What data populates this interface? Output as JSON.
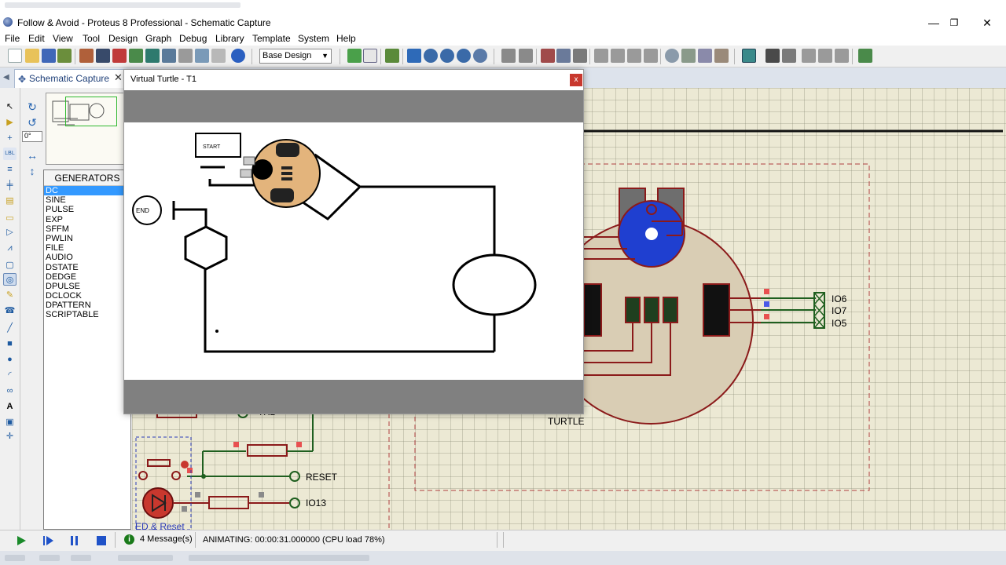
{
  "window": {
    "title": "Follow & Avoid - Proteus 8 Professional - Schematic Capture",
    "controls": [
      "—",
      "❐",
      "✕"
    ]
  },
  "menu": [
    "File",
    "Edit",
    "View",
    "Tool",
    "Design",
    "Graph",
    "Debug",
    "Library",
    "Template",
    "System",
    "Help"
  ],
  "toolbar": {
    "design_select": "Base Design",
    "icons": [
      "new-icon",
      "open-icon",
      "save-icon",
      "import-icon",
      "home-icon",
      "pcb-icon",
      "component-icon",
      "back-icon",
      "gerber-icon",
      "3d-icon",
      "bom-icon",
      "notes-icon",
      "script-icon",
      "help-icon",
      "refresh-icon",
      "grid-icon",
      "origin-icon",
      "pan-icon",
      "zoom-in-icon",
      "zoom-out-icon",
      "zoom-all-icon",
      "zoom-area-icon",
      "undo-icon",
      "redo-icon",
      "cut-icon",
      "copy-icon",
      "paste-icon",
      "block-copy-icon",
      "block-move-icon",
      "block-rotate-icon",
      "block-delete-icon",
      "pick-device-icon",
      "make-device-icon",
      "package-icon",
      "decompose-icon",
      "wire-autorouter-icon",
      "search-icon",
      "property-assign-icon",
      "new-sheet-icon",
      "remove-sheet-icon",
      "exit-to-parent-icon",
      "electrical-check-icon"
    ]
  },
  "tab": {
    "label": "Schematic Capture"
  },
  "overview": {
    "angle": "0°"
  },
  "generators": {
    "header": "GENERATORS",
    "items": [
      "DC",
      "SINE",
      "PULSE",
      "EXP",
      "SFFM",
      "PWLIN",
      "FILE",
      "AUDIO",
      "DSTATE",
      "DEDGE",
      "DPULSE",
      "DCLOCK",
      "DPATTERN",
      "SCRIPTABLE"
    ],
    "selected": "DC"
  },
  "virtual_turtle": {
    "title": "Virtual Turtle - T1",
    "close": "x",
    "start_label": "START",
    "end_label": "END"
  },
  "schematic": {
    "component_label": "TURTLE",
    "pins": [
      "IO6",
      "IO7",
      "IO5"
    ],
    "nets": [
      "TXD",
      "RESET",
      "IO13"
    ],
    "subcircuit_label": "ED & Reset"
  },
  "status": {
    "messages": "4 Message(s)",
    "animating": "ANIMATING: 00:00:31.000000 (CPU load 78%)"
  },
  "colors": {
    "grid_bg": "#ece9d4",
    "wire_green": "#1f5f1f",
    "component_red": "#8b1a1a",
    "turtle_body": "#d9cdb4",
    "sensor_blue": "#1f3fd0",
    "selection_blue": "#3399ff"
  }
}
